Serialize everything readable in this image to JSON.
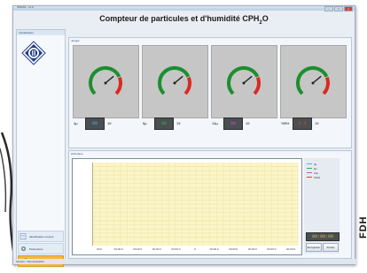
{
  "window": {
    "titlebar_text": "CPH2O - v1.0",
    "minimize_label": "–",
    "maximize_label": "□",
    "close_label": "x"
  },
  "app": {
    "title_main": "Compteur de particules et d'humidité CPH",
    "title_sub": "2",
    "title_tail": "O"
  },
  "left_panel": {
    "header": "Visualisation",
    "nav": [
      {
        "label": "Identification mesure",
        "icon": "document-icon"
      },
      {
        "label": "Paramètres",
        "icon": "settings-icon"
      },
      {
        "label": "Visualisation",
        "icon": "chart-icon"
      }
    ]
  },
  "gauges": {
    "header": "Jauges",
    "items": [
      {
        "label": "4µ",
        "display": "00",
        "value": "19",
        "display_color": "#46b7e8"
      },
      {
        "label": "6µ",
        "display": "00",
        "value": "19",
        "display_color": "#38b34a"
      },
      {
        "label": "14µ",
        "display": "00",
        "value": "19",
        "display_color": "#d84bd0"
      },
      {
        "label": "%RH",
        "display": "0.0",
        "value": "19",
        "display_color": "#e0412f"
      }
    ]
  },
  "history": {
    "header": "Historique",
    "xticks": [
      "00:0",
      "00:00:0",
      "00:00:0",
      "00:00:0",
      "00:00:0",
      "0",
      "00:00:0",
      "00:00:0",
      "00:00:0",
      "00:00:0",
      "00:00:0"
    ],
    "legend": [
      {
        "label": "4µ",
        "color": "#46b7e8"
      },
      {
        "label": "6µ",
        "color": "#38b34a"
      },
      {
        "label": "14µ",
        "color": "#d84bd0"
      },
      {
        "label": "%RH",
        "color": "#e0412f"
      }
    ],
    "timer": "00:00:00",
    "record_button": "Enregistrer",
    "stop_button": "Arrêter"
  },
  "statusbar": {
    "text": "Version : Démonstration"
  },
  "side_text": "FDH"
}
